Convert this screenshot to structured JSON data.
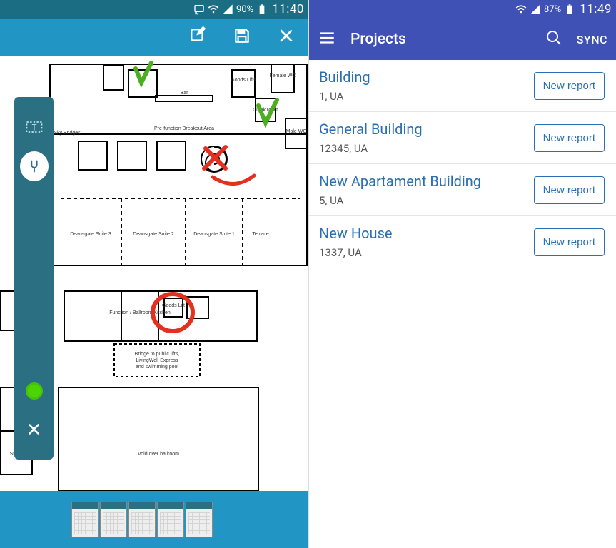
{
  "left": {
    "status": {
      "battery": "90%",
      "time": "11:40"
    },
    "tools": {
      "text_tool": "text-select-icon",
      "draw_tool": "tuning-fork-icon",
      "color_indicator": "color-dot",
      "close": "✕"
    },
    "floorplan": {
      "labels": {
        "sky_bridges": "Sky Bridges",
        "bar": "Bar",
        "prefunction": "Pre-function Breakout Area",
        "goods_lifts": "Goods Lifts",
        "cloak_room": "Cloak room",
        "female_wc": "Female WC",
        "male_wc": "Male WC",
        "deansgate1": "Deansgate Suite 1",
        "deansgate2": "Deansgate Suite 2",
        "deansgate3": "Deansgate Suite 3",
        "terrace": "Terrace",
        "function_kitchen": "Function / Ballroom Kitchen",
        "goods_lift": "Goods Lift",
        "bridge_caption": "Bridge to public lifts,\nLivingWell Express\nand swimming pool",
        "void": "Void over ballroom",
        "store": "Store"
      }
    }
  },
  "right": {
    "status": {
      "battery": "87%",
      "time": "11:49"
    },
    "header": {
      "title": "Projects",
      "sync": "SYNC"
    },
    "new_report_label": "New report",
    "projects": [
      {
        "name": "Building",
        "sub": "1, UA"
      },
      {
        "name": "General Building",
        "sub": "12345, UA"
      },
      {
        "name": "New Apartament Building",
        "sub": "5, UA"
      },
      {
        "name": "New House",
        "sub": "1337, UA"
      }
    ]
  }
}
